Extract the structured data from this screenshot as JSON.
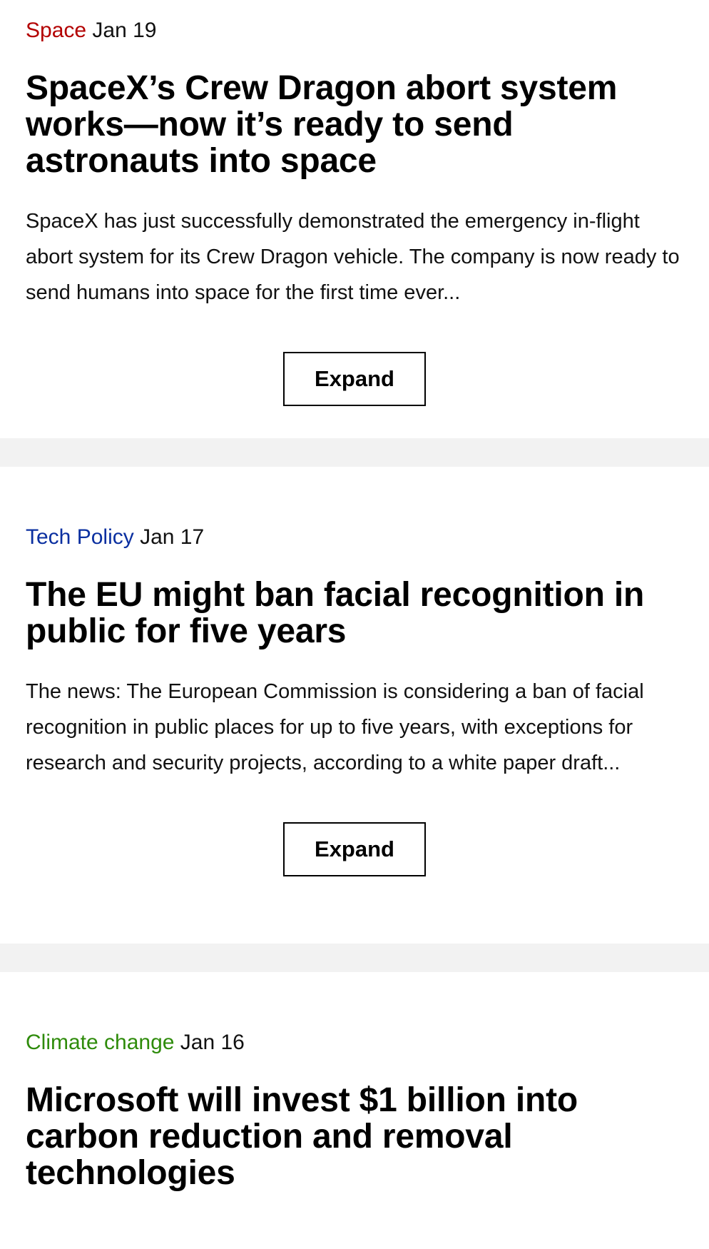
{
  "colors": {
    "space": "#b30000",
    "tech_policy": "#0a2fa0",
    "climate_change": "#2e8b0a",
    "divider": "#f2f2f2"
  },
  "articles": [
    {
      "category": "Space",
      "date": "Jan 19",
      "headline": "SpaceX’s Crew Dragon abort system works—now it’s ready to send astronauts into space",
      "summary": "SpaceX has just successfully demonstrated the emergency in-flight abort system for its Crew Dragon vehicle. The company is now ready to send humans into space for the first time ever...",
      "expand_label": "Expand"
    },
    {
      "category": "Tech Policy",
      "date": "Jan 17",
      "headline": "The EU might ban facial recognition in public for five years",
      "summary": "The news: The European Commission is considering a ban of facial recognition in public places for up to five years, with exceptions for research and security projects, according to a white paper draft...",
      "expand_label": "Expand"
    },
    {
      "category": "Climate change",
      "date": "Jan 16",
      "headline": "Microsoft will invest $1 billion into carbon reduction and removal technologies"
    }
  ]
}
